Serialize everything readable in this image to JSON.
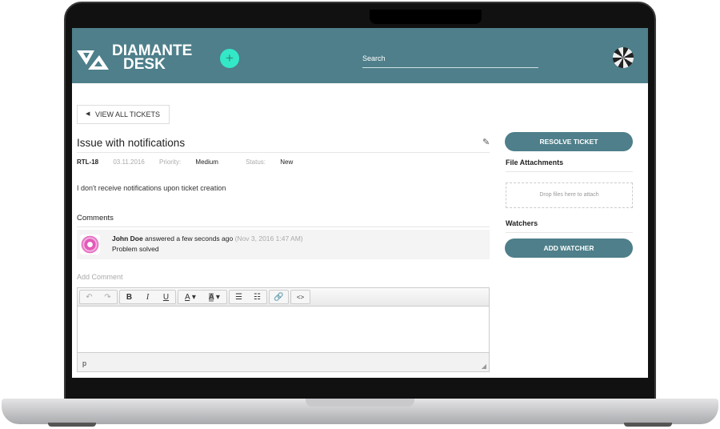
{
  "header": {
    "logo_text_line1": "DIAMANTE",
    "logo_text_line2": "DESK",
    "search_placeholder": "Search",
    "accent": "#4e7f8a",
    "plus_color": "#33e8c7"
  },
  "nav": {
    "back_label": "VIEW ALL TICKETS"
  },
  "ticket": {
    "title": "Issue with notifications",
    "key": "RTL-18",
    "date": "03.11.2016",
    "priority_label": "Priority:",
    "priority": "Medium",
    "status_label": "Status:",
    "status": "New",
    "description": "I don't receive notifications upon ticket creation"
  },
  "comments": {
    "heading": "Comments",
    "items": [
      {
        "author": "John Doe",
        "action": "answered a few seconds ago",
        "timestamp": "(Nov 3, 2016 1:47 AM)",
        "text": "Problem solved"
      }
    ]
  },
  "editor": {
    "label": "Add Comment",
    "status_path": "p",
    "toolbar": [
      [
        "undo-icon",
        "redo-icon"
      ],
      [
        "bold-icon",
        "italic-icon",
        "underline-icon"
      ],
      [
        "text-color-icon",
        "background-color-icon"
      ],
      [
        "bullet-list-icon",
        "numbered-list-icon"
      ],
      [
        "link-icon"
      ],
      [
        "code-icon"
      ]
    ]
  },
  "sidebar": {
    "resolve_label": "RESOLVE TICKET",
    "attachments_heading": "File Attachments",
    "drop_text": "Drop files here to attach",
    "watchers_heading": "Watchers",
    "add_watcher_label": "ADD WATCHER"
  }
}
